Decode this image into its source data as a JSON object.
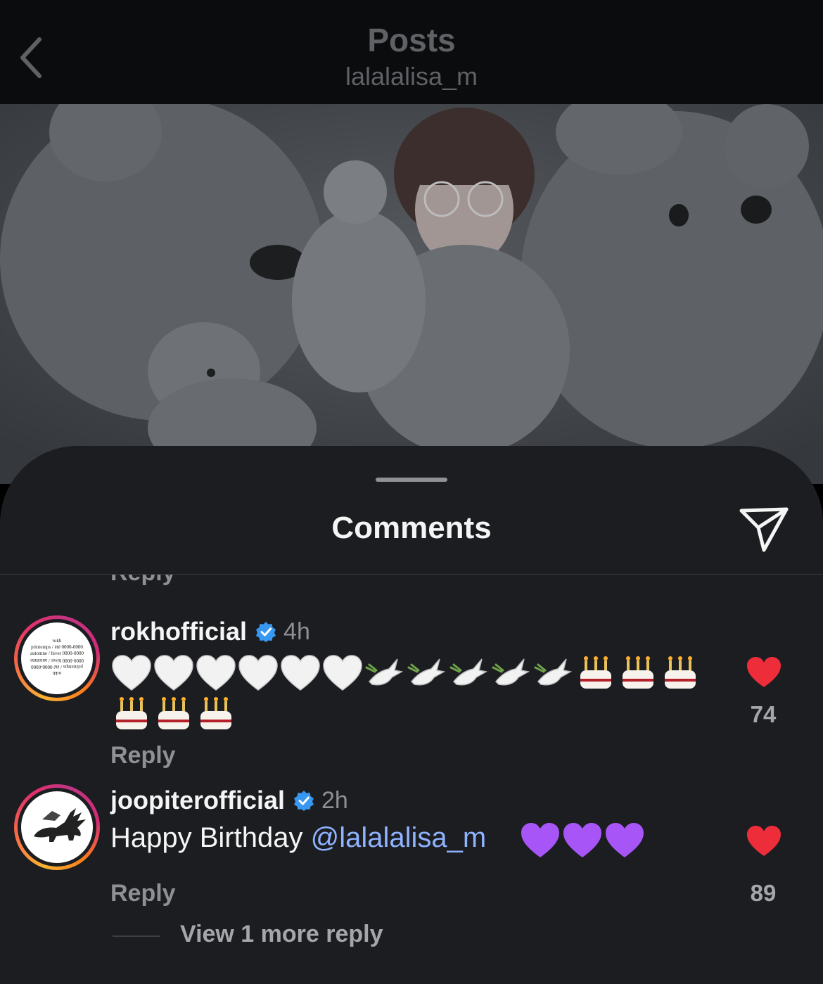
{
  "header": {
    "title": "Posts",
    "subtitle": "lalalalisa_m"
  },
  "sheet": {
    "title": "Comments",
    "prev_reply_label": "Reply"
  },
  "comments": [
    {
      "username": "rokhofficial",
      "verified": true,
      "time": "4h",
      "avatar_text": [
        "rokh",
        "printemps / été 0000-0000",
        "automne / hiver 0000-0000",
        "0000-0000 hiver / automne",
        "printemps / été 0000-0000",
        "rokh"
      ],
      "emoji_line1": [
        "white-heart",
        "white-heart",
        "white-heart",
        "white-heart",
        "white-heart",
        "white-heart",
        "dove",
        "dove",
        "dove",
        "dove",
        "dove",
        "birthday-cake",
        "birthday-cake",
        "birthday-cake"
      ],
      "emoji_line2": [
        "birthday-cake",
        "birthday-cake",
        "birthday-cake"
      ],
      "reply_label": "Reply",
      "likes": "74",
      "liked": true
    },
    {
      "username": "joopiterofficial",
      "verified": true,
      "time": "2h",
      "text": "Happy Birthday ",
      "mention": "@lalalalisa_m",
      "emoji": [
        "purple-heart",
        "purple-heart",
        "purple-heart"
      ],
      "reply_label": "Reply",
      "likes": "89",
      "liked": true
    }
  ],
  "view_more_replies": "View 1 more reply",
  "colors": {
    "like_red": "#ed2d3a",
    "mention_blue": "#8fb3ff",
    "verified_blue": "#3897f0",
    "purple_heart": "#a855f7"
  }
}
